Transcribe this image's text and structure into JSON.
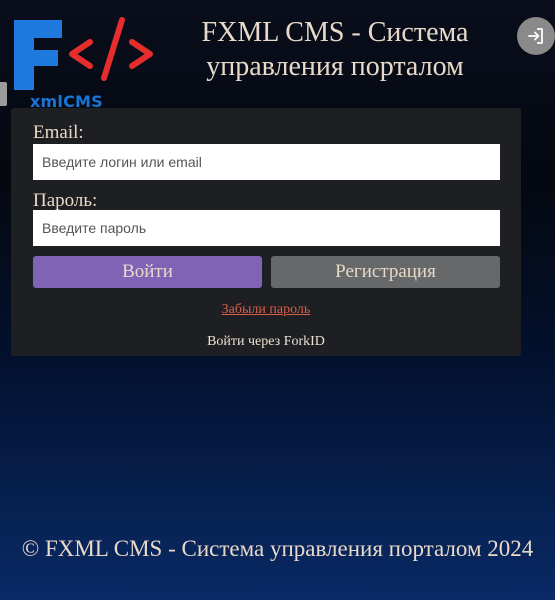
{
  "header": {
    "logo_text": "xmlCMS",
    "title": "FXML CMS - Система управления порталом"
  },
  "icons": {
    "logo": "fxml-logo-icon",
    "login": "sign-in-icon"
  },
  "form": {
    "email_label": "Email:",
    "email_placeholder": "Введите логин или email",
    "password_label": "Пароль:",
    "password_placeholder": "Введите пароль",
    "login_button": "Войти",
    "register_button": "Регистрация",
    "forgot_link": "Забыли пароль",
    "forkid_link": "Войти через ForkID"
  },
  "footer": {
    "text": "© FXML CMS - Система управления порталом 2024"
  },
  "colors": {
    "login_button": "#7f64b5",
    "register_button": "#66686a",
    "card": "#1e1f22",
    "forgot_link": "#d85d4a",
    "logo_blue": "#1a74d6",
    "logo_red": "#e52d2d"
  }
}
